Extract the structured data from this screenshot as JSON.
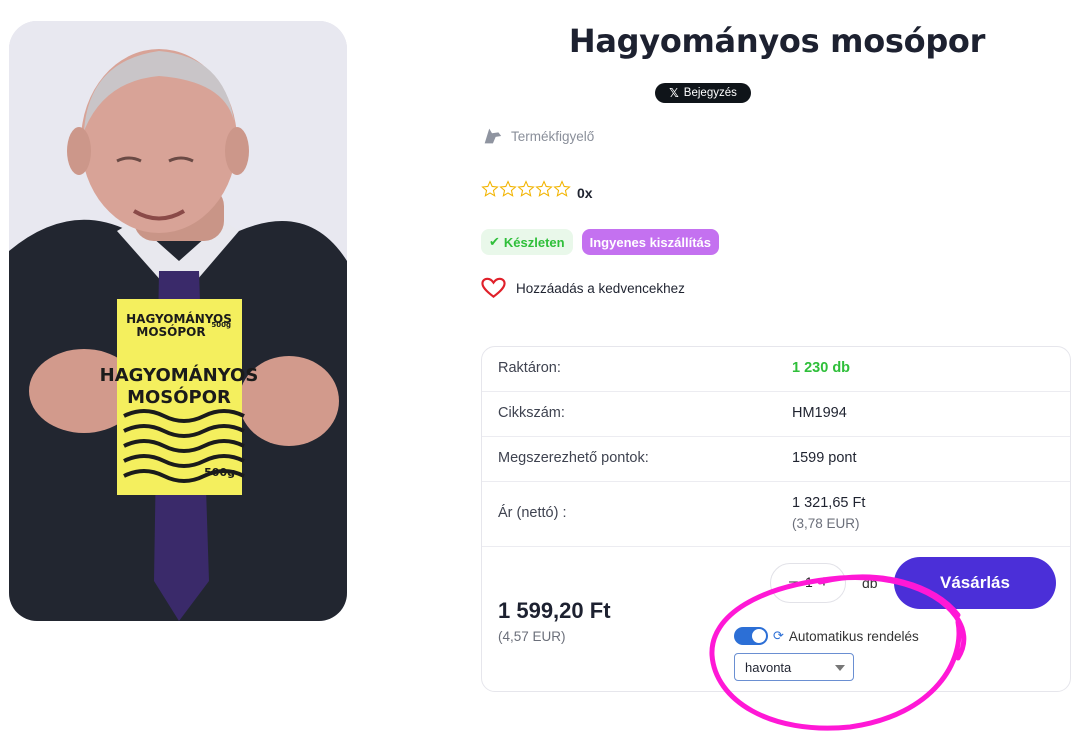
{
  "product": {
    "title": "Hagyományos mosópor",
    "package_text_small_1": "HAGYOMÁNYOS",
    "package_text_small_2": "MOSÓPOR",
    "package_weight_small": "500g",
    "package_text_large_1": "HAGYOMÁNYOS",
    "package_text_large_2": "MOSÓPOR",
    "package_weight": "500g"
  },
  "social": {
    "x_post_label": "Bejegyzés",
    "x_logo": "𝕏"
  },
  "watch": {
    "label": "Termékfigyelő",
    "icon": "dog-icon"
  },
  "rating": {
    "stars_filled": 0,
    "stars_total": 5,
    "count": "0x",
    "star_color": "#f2b400"
  },
  "badges": {
    "stock": "Készleten",
    "shipping": "Ingyenes kiszállítás"
  },
  "favorite": {
    "label": "Hozzáadás a kedvencekhez",
    "icon": "heart-icon",
    "color": "#e0202a"
  },
  "details": {
    "stock_label": "Raktáron:",
    "stock_value": "1 230 db",
    "sku_label": "Cikkszám:",
    "sku_value": "HM1994",
    "points_label": "Megszerezhető pontok:",
    "points_value": "1599 pont",
    "net_price_label": "Ár (nettó) :",
    "net_price_value": "1 321,65 Ft",
    "net_price_eur": "(3,78 EUR)"
  },
  "purchase": {
    "gross_price": "1 599,20 Ft",
    "gross_price_eur": "(4,57 EUR)",
    "quantity_minus": "–",
    "quantity": "1",
    "quantity_plus": "+",
    "quantity_unit": "db",
    "buy_label": "Vásárlás",
    "auto_order_label": "Automatikus rendelés",
    "auto_order_enabled": true,
    "frequency": "havonta"
  },
  "colors": {
    "accent": "#4b2fd8",
    "success": "#2fbf3a",
    "badge_purple": "#c471f0",
    "annotation": "#ff18d6"
  }
}
